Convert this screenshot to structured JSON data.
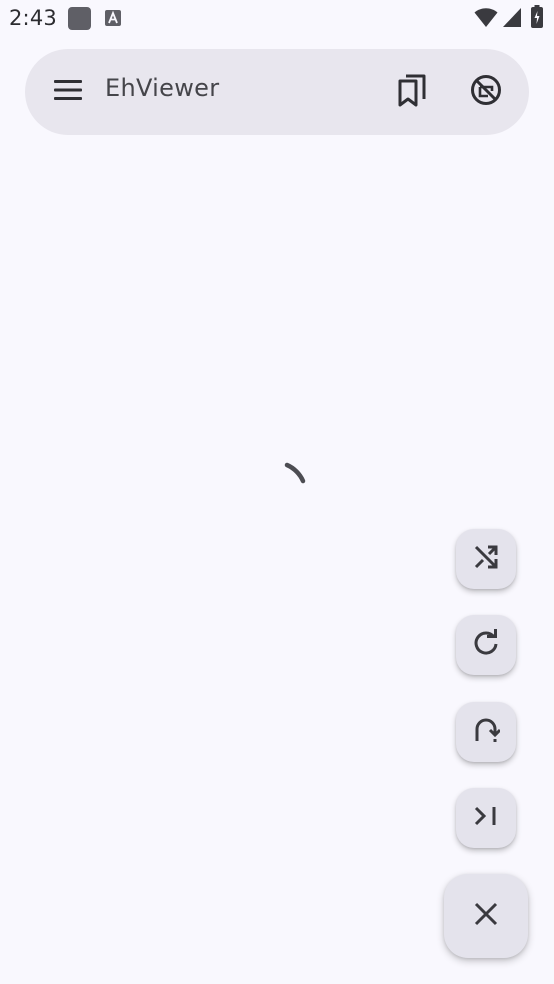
{
  "status_bar": {
    "time": "2:43",
    "icons": [
      "app-notification-icon",
      "a-letter-notification-icon",
      "wifi-icon",
      "cellular-signal-icon",
      "battery-icon"
    ]
  },
  "search_bar": {
    "title": "EhViewer",
    "menu_icon": "hamburger-menu-icon",
    "bookmark_icon": "bookmarks-icon",
    "block_icon": "block-icon"
  },
  "loading": {
    "icon": "loading-spinner"
  },
  "fabs": [
    {
      "name": "shuffle-button",
      "icon": "shuffle-icon"
    },
    {
      "name": "refresh-button",
      "icon": "refresh-icon"
    },
    {
      "name": "go-to-button",
      "icon": "go-to-icon"
    },
    {
      "name": "skip-to-last-button",
      "icon": "skip-to-last-icon"
    },
    {
      "name": "close-button",
      "icon": "close-icon"
    }
  ],
  "colors": {
    "background": "#f9f8fe",
    "search_bar": "#e8e6ee",
    "fab": "#e4e3ec",
    "icon": "#45454a"
  }
}
